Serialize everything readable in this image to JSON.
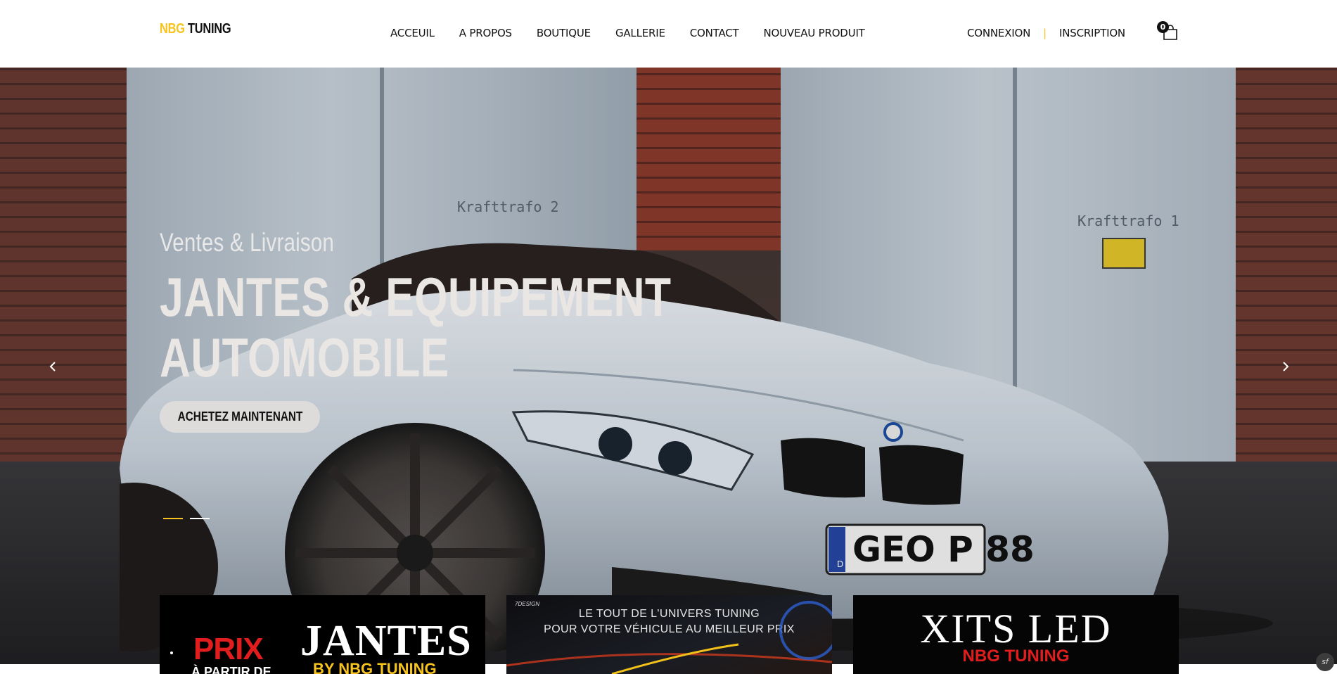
{
  "header": {
    "logo": {
      "part1": "NBG",
      "part2": "TUNING"
    },
    "nav": [
      "ACCEUIL",
      "A PROPOS",
      "BOUTIQUE",
      "GALLERIE",
      "CONTACT",
      "NOUVEAU PRODUIT"
    ],
    "auth": {
      "login": "CONNEXION",
      "separator": "|",
      "register": "INSCRIPTION"
    },
    "cart": {
      "icon": "shopping-bag-icon",
      "count": "0"
    }
  },
  "hero": {
    "subtitle": "Ventes & Livraison",
    "title_line1": "JANTES & EQUIPEMENT",
    "title_line2": "AUTOMOBILE",
    "cta": "ACHETEZ MAINTENANT",
    "prev_icon": "chevron-left-icon",
    "next_icon": "chevron-right-icon",
    "slides_total": 2,
    "slide_active": 1,
    "image_text": {
      "door_left": "Krafttrafo 2",
      "door_right": "Krafttrafo 1",
      "plate_country": "D",
      "plate": "GEO P 88"
    }
  },
  "banners": [
    {
      "prix": "PRIX",
      "apartir": "À PARTIR DE",
      "jantes": "JANTES",
      "by": "BY NBG TUNING"
    },
    {
      "brand": "7DESIGN",
      "line1": "LE TOUT DE L'UNIVERS TUNING",
      "line2": "POUR VOTRE VÉHICULE AU MEILLEUR PRIX"
    },
    {
      "title": "XITS LED",
      "subtitle": "NBG TUNING"
    }
  ],
  "debug_badge": "sf",
  "colors": {
    "accent": "#f7c41f",
    "red": "#e21d1d",
    "text": "#111111"
  }
}
